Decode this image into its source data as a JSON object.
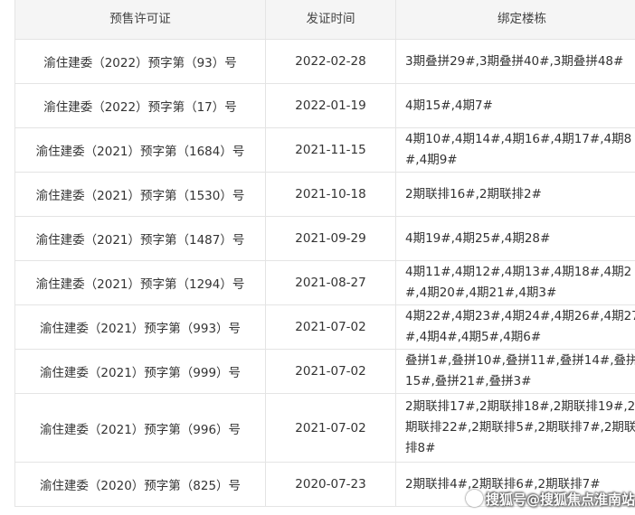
{
  "header": {
    "permit": "预售许可证",
    "date": "发证时间",
    "buildings": "绑定楼栋"
  },
  "rows": [
    {
      "permit": "渝住建委（2022）预字第（93）号",
      "date": "2022-02-28",
      "buildings": "3期叠拼29#,3期叠拼40#,3期叠拼48#"
    },
    {
      "permit": "渝住建委（2022）预字第（17）号",
      "date": "2022-01-19",
      "buildings": "4期15#,4期7#"
    },
    {
      "permit": "渝住建委（2021）预字第（1684）号",
      "date": "2021-11-15",
      "buildings": "4期10#,4期14#,4期16#,4期17#,4期8#,4期9#"
    },
    {
      "permit": "渝住建委（2021）预字第（1530）号",
      "date": "2021-10-18",
      "buildings": "2期联排16#,2期联排2#"
    },
    {
      "permit": "渝住建委（2021）预字第（1487）号",
      "date": "2021-09-29",
      "buildings": "4期19#,4期25#,4期28#"
    },
    {
      "permit": "渝住建委（2021）预字第（1294）号",
      "date": "2021-08-27",
      "buildings": "4期11#,4期12#,4期13#,4期18#,4期2#,4期20#,4期21#,4期3#"
    },
    {
      "permit": "渝住建委（2021）预字第（993）号",
      "date": "2021-07-02",
      "buildings": "4期22#,4期23#,4期24#,4期26#,4期27#,4期4#,4期5#,4期6#"
    },
    {
      "permit": "渝住建委（2021）预字第（999）号",
      "date": "2021-07-02",
      "buildings": "叠拼1#,叠拼10#,叠拼11#,叠拼14#,叠拼15#,叠拼21#,叠拼3#"
    },
    {
      "permit": "渝住建委（2021）预字第（996）号",
      "date": "2021-07-02",
      "buildings": "2期联排17#,2期联排18#,2期联排19#,2期联排22#,2期联排5#,2期联排7#,2期联排8#"
    },
    {
      "permit": "渝住建委（2020）预字第（825）号",
      "date": "2020-07-23",
      "buildings": "2期联排4#,2期联排6#,2期联排7#"
    }
  ],
  "watermark": "搜狐号@搜狐焦点淮南站"
}
